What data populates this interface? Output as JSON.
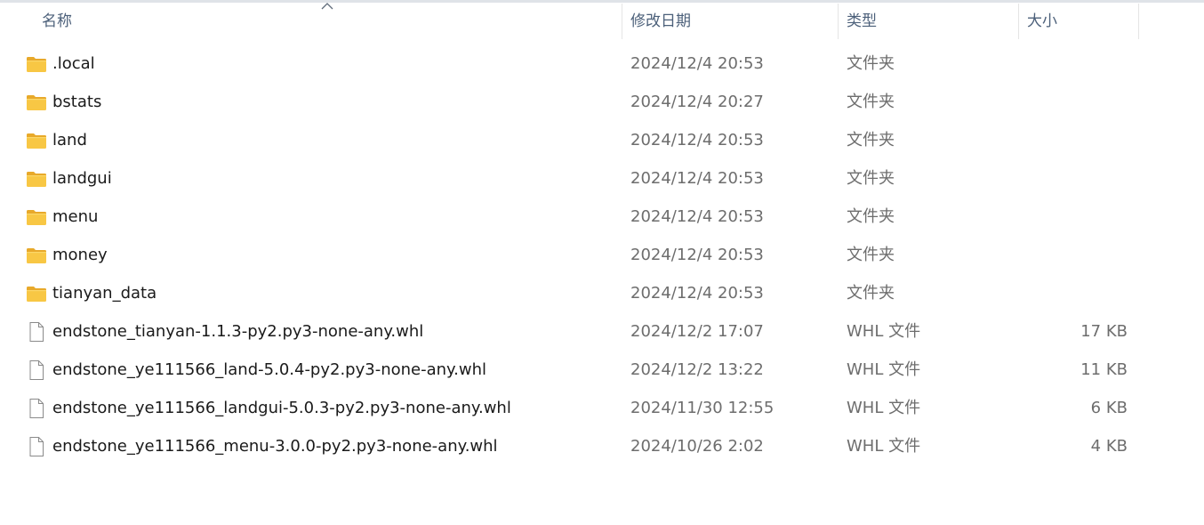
{
  "columns": {
    "name": "名称",
    "date": "修改日期",
    "type": "类型",
    "size": "大小"
  },
  "files": [
    {
      "name": ".local",
      "date": "2024/12/4 20:53",
      "type": "文件夹",
      "size": "",
      "icon": "folder-icon"
    },
    {
      "name": "bstats",
      "date": "2024/12/4 20:27",
      "type": "文件夹",
      "size": "",
      "icon": "folder-icon"
    },
    {
      "name": "land",
      "date": "2024/12/4 20:53",
      "type": "文件夹",
      "size": "",
      "icon": "folder-icon"
    },
    {
      "name": "landgui",
      "date": "2024/12/4 20:53",
      "type": "文件夹",
      "size": "",
      "icon": "folder-icon"
    },
    {
      "name": "menu",
      "date": "2024/12/4 20:53",
      "type": "文件夹",
      "size": "",
      "icon": "folder-icon"
    },
    {
      "name": "money",
      "date": "2024/12/4 20:53",
      "type": "文件夹",
      "size": "",
      "icon": "folder-icon"
    },
    {
      "name": "tianyan_data",
      "date": "2024/12/4 20:53",
      "type": "文件夹",
      "size": "",
      "icon": "folder-icon"
    },
    {
      "name": "endstone_tianyan-1.1.3-py2.py3-none-any.whl",
      "date": "2024/12/2 17:07",
      "type": "WHL 文件",
      "size": "17 KB",
      "icon": "file-icon"
    },
    {
      "name": "endstone_ye111566_land-5.0.4-py2.py3-none-any.whl",
      "date": "2024/12/2 13:22",
      "type": "WHL 文件",
      "size": "11 KB",
      "icon": "file-icon"
    },
    {
      "name": "endstone_ye111566_landgui-5.0.3-py2.py3-none-any.whl",
      "date": "2024/11/30 12:55",
      "type": "WHL 文件",
      "size": "6 KB",
      "icon": "file-icon"
    },
    {
      "name": "endstone_ye111566_menu-3.0.0-py2.py3-none-any.whl",
      "date": "2024/10/26 2:02",
      "type": "WHL 文件",
      "size": "4 KB",
      "icon": "file-icon"
    }
  ],
  "colors": {
    "header_text": "#4c607a",
    "folder_body": "#f8c744",
    "folder_back": "#e8a92a",
    "file_outline": "#8a8a8a"
  },
  "sort": {
    "column": "name",
    "direction": "ascending",
    "icon": "sort-up-icon"
  }
}
